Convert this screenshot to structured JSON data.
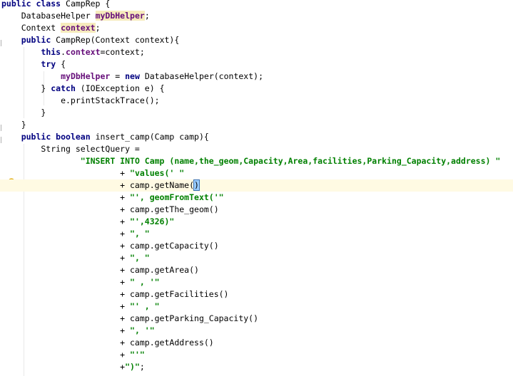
{
  "editor": {
    "lines": [
      [
        {
          "t": "public class ",
          "c": "kw"
        },
        {
          "t": "CampRep {",
          "c": ""
        }
      ],
      [
        {
          "t": "    DatabaseHelper ",
          "c": ""
        },
        {
          "t": "myDbHelper",
          "c": "field hl"
        },
        {
          "t": ";",
          "c": ""
        }
      ],
      [
        {
          "t": "    Context ",
          "c": ""
        },
        {
          "t": "context",
          "c": "field hl"
        },
        {
          "t": ";",
          "c": ""
        }
      ],
      [
        {
          "t": "    ",
          "c": ""
        },
        {
          "t": "public ",
          "c": "kw"
        },
        {
          "t": "CampRep(Context context){",
          "c": ""
        }
      ],
      [
        {
          "t": "        ",
          "c": ""
        },
        {
          "t": "this",
          "c": "kw"
        },
        {
          "t": ".",
          "c": ""
        },
        {
          "t": "context",
          "c": "field"
        },
        {
          "t": "=context;",
          "c": ""
        }
      ],
      [
        {
          "t": "        ",
          "c": ""
        },
        {
          "t": "try ",
          "c": "kw"
        },
        {
          "t": "{",
          "c": ""
        }
      ],
      [
        {
          "t": "            ",
          "c": ""
        },
        {
          "t": "myDbHelper",
          "c": "field"
        },
        {
          "t": " = ",
          "c": ""
        },
        {
          "t": "new ",
          "c": "kw"
        },
        {
          "t": "DatabaseHelper(context);",
          "c": ""
        }
      ],
      [
        {
          "t": "        } ",
          "c": ""
        },
        {
          "t": "catch ",
          "c": "kw"
        },
        {
          "t": "(IOException e) {",
          "c": ""
        }
      ],
      [
        {
          "t": "            e.printStackTrace();",
          "c": ""
        }
      ],
      [
        {
          "t": "        }",
          "c": ""
        }
      ],
      [
        {
          "t": "    }",
          "c": ""
        }
      ],
      [
        {
          "t": "    ",
          "c": ""
        },
        {
          "t": "public boolean ",
          "c": "kw"
        },
        {
          "t": "insert_camp(Camp camp){",
          "c": ""
        }
      ],
      [
        {
          "t": "        String selectQuery =",
          "c": ""
        }
      ],
      [
        {
          "t": "                ",
          "c": ""
        },
        {
          "t": "\"INSERT INTO Camp (name,the_geom,Capacity,Area,facilities,Parking_Capacity,address) \"",
          "c": "str"
        }
      ],
      [
        {
          "t": "                        + ",
          "c": ""
        },
        {
          "t": "\"values(' \"",
          "c": "str"
        }
      ],
      [
        {
          "t": "                        + camp.getName(",
          "c": ""
        },
        {
          "t": ")",
          "c": "brace-hl"
        }
      ],
      [
        {
          "t": "                        + ",
          "c": ""
        },
        {
          "t": "\"', geomFromText('\"",
          "c": "str"
        }
      ],
      [
        {
          "t": "                        + camp.getThe_geom()",
          "c": ""
        }
      ],
      [
        {
          "t": "                        + ",
          "c": ""
        },
        {
          "t": "\"',4326)\"",
          "c": "str"
        }
      ],
      [
        {
          "t": "                        + ",
          "c": ""
        },
        {
          "t": "\", \"",
          "c": "str"
        }
      ],
      [
        {
          "t": "                        + camp.getCapacity()",
          "c": ""
        }
      ],
      [
        {
          "t": "                        + ",
          "c": ""
        },
        {
          "t": "\", \"",
          "c": "str"
        }
      ],
      [
        {
          "t": "                        + camp.getArea()",
          "c": ""
        }
      ],
      [
        {
          "t": "                        + ",
          "c": ""
        },
        {
          "t": "\" , '\"",
          "c": "str"
        }
      ],
      [
        {
          "t": "                        + camp.getFacilities()",
          "c": ""
        }
      ],
      [
        {
          "t": "                        + ",
          "c": ""
        },
        {
          "t": "\"' , \"",
          "c": "str"
        }
      ],
      [
        {
          "t": "                        + camp.getParking_Capacity()",
          "c": ""
        }
      ],
      [
        {
          "t": "                        + ",
          "c": ""
        },
        {
          "t": "\", '\"",
          "c": "str"
        }
      ],
      [
        {
          "t": "                        + camp.getAddress()",
          "c": ""
        }
      ],
      [
        {
          "t": "                        + ",
          "c": ""
        },
        {
          "t": "\"'\"",
          "c": "str"
        }
      ],
      [
        {
          "t": "                        +",
          "c": ""
        },
        {
          "t": "\")\"",
          "c": "str"
        },
        {
          "t": ";",
          "c": ""
        }
      ]
    ],
    "caret_line_index": 15,
    "intention_icon": "lightbulb-icon",
    "colors": {
      "keyword": "#000080",
      "field": "#660e7a",
      "string": "#008000",
      "caret_line": "#fffae3",
      "usage_highlight": "#f6ebbc"
    }
  }
}
